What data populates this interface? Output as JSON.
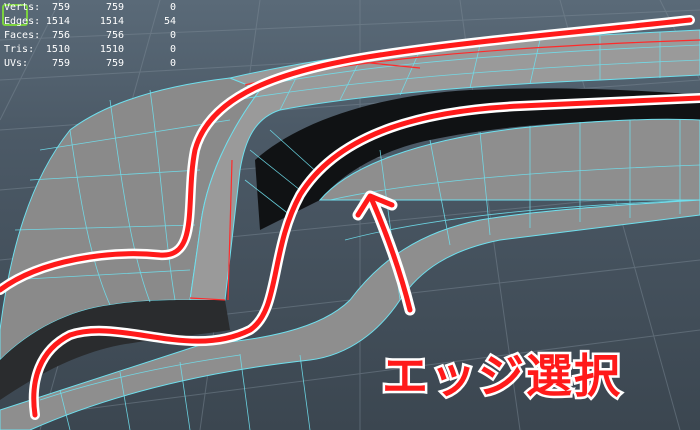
{
  "hud": {
    "rows": [
      {
        "label": "Verts:",
        "v1": "759",
        "v2": "759",
        "v3": "0"
      },
      {
        "label": "Edges:",
        "v1": "1514",
        "v2": "1514",
        "v3": "54"
      },
      {
        "label": "Faces:",
        "v1": "756",
        "v2": "756",
        "v3": "0"
      },
      {
        "label": "Tris:",
        "v1": "1510",
        "v2": "1510",
        "v3": "0"
      },
      {
        "label": "UVs:",
        "v1": "759",
        "v2": "759",
        "v3": "0"
      }
    ]
  },
  "annotation": {
    "text": "エッジ選択"
  },
  "colors": {
    "wire": "#6fe0ee",
    "annotation": "#ff1a1a",
    "outline": "#ffffff",
    "badge": "#7bd13f",
    "selected_edge": "#ff2a2a"
  },
  "icons": {
    "arrow": "arrow-up-icon",
    "badge": "green-frame-icon"
  }
}
